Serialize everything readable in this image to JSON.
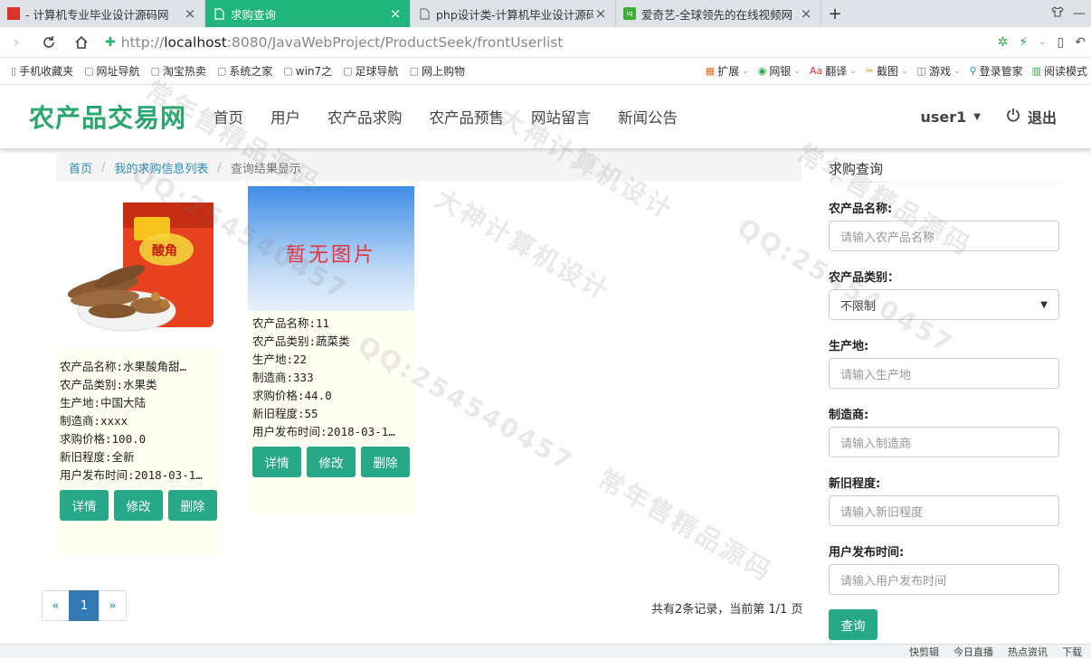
{
  "browser": {
    "tabs": [
      {
        "label": "- 计算机专业毕业设计源码网",
        "active": false
      },
      {
        "label": "求购查询",
        "active": true
      },
      {
        "label": "php设计类-计算机毕业设计源码",
        "active": false
      },
      {
        "label": "爱奇艺-全球领先的在线视频网",
        "active": false
      }
    ],
    "url_prefix": "http://",
    "url_host": "localhost",
    "url_path": ":8080/JavaWebProject/ProductSeek/frontUserlist",
    "bookmarks": [
      "手机收藏夹",
      "网址导航",
      "淘宝热卖",
      "系统之家",
      "win7之",
      "足球导航",
      "网上购物"
    ],
    "toolbar_right": [
      "扩展",
      "网银",
      "翻译",
      "截图",
      "游戏",
      "登录管家",
      "阅读模式"
    ],
    "status_items": [
      "快剪辑",
      "今日直播",
      "热点资讯",
      "下载"
    ]
  },
  "site": {
    "brand": "农产品交易网",
    "menu": [
      "首页",
      "用户",
      "农产品求购",
      "农产品预售",
      "网站留言",
      "新闻公告"
    ],
    "user": "user1",
    "logout": "退出",
    "accent": "#26a889"
  },
  "breadcrumb": {
    "home": "首页",
    "list": "我的求购信息列表",
    "current": "查询结果显示"
  },
  "products": [
    {
      "image": "product-photo",
      "name": "农产品名称:水果酸角甜…",
      "category": "农产品类别:水果类",
      "origin": "生产地:中国大陆",
      "maker": "制造商:xxxx",
      "price": "求购价格:100.0",
      "condition": "新旧程度:全新",
      "published": "用户发布时间:2018-03-1…",
      "btn_detail": "详情",
      "btn_edit": "修改",
      "btn_delete": "删除"
    },
    {
      "image_text": "暂无图片",
      "name": "农产品名称:11",
      "category": "农产品类别:蔬菜类",
      "origin": "生产地:22",
      "maker": "制造商:333",
      "price": "求购价格:44.0",
      "condition": "新旧程度:55",
      "published": "用户发布时间:2018-03-1…",
      "btn_detail": "详情",
      "btn_edit": "修改",
      "btn_delete": "删除"
    }
  ],
  "pagination": {
    "prev": "«",
    "current": "1",
    "next": "»",
    "summary": "共有2条记录，当前第 1/1 页"
  },
  "search": {
    "title": "求购查询",
    "name_label": "农产品名称:",
    "name_placeholder": "请输入农产品名称",
    "category_label": "农产品类别：",
    "category_value": "不限制",
    "origin_label": "生产地:",
    "origin_placeholder": "请输入生产地",
    "maker_label": "制造商:",
    "maker_placeholder": "请输入制造商",
    "condition_label": "新旧程度:",
    "condition_placeholder": "请输入新旧程度",
    "published_label": "用户发布时间:",
    "published_placeholder": "请输入用户发布时间",
    "submit": "查询"
  },
  "watermarks": [
    "QQ:254540457",
    "大神计算机设计",
    "常年售精品源码"
  ]
}
